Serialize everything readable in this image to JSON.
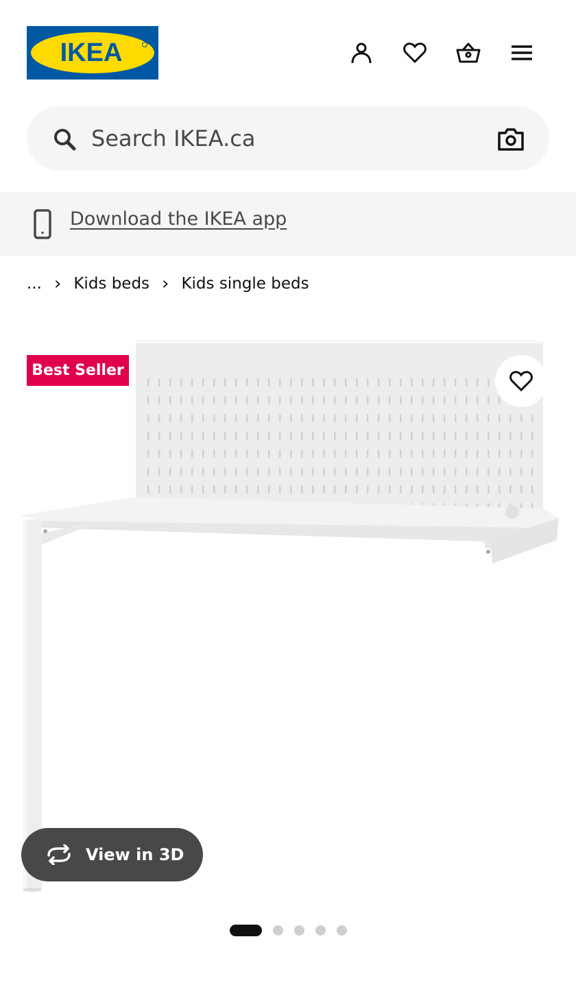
{
  "brand": {
    "logo_text": "IKEA",
    "primary_blue": "#0058a3",
    "primary_yellow": "#ffdb00"
  },
  "header": {
    "icons": [
      "account-icon",
      "heart-icon",
      "shopping-bag-icon",
      "menu-icon"
    ]
  },
  "search": {
    "placeholder": "Search IKEA.ca",
    "value": ""
  },
  "app_banner": {
    "link_text": "Download the IKEA app"
  },
  "breadcrumb": {
    "items": [
      "...",
      "Kids beds",
      "Kids single beds"
    ]
  },
  "product": {
    "badge": "Best Seller",
    "badge_color": "#e0004d",
    "view_3d_label": "View in 3D",
    "image_count": 5,
    "active_image": 1
  }
}
